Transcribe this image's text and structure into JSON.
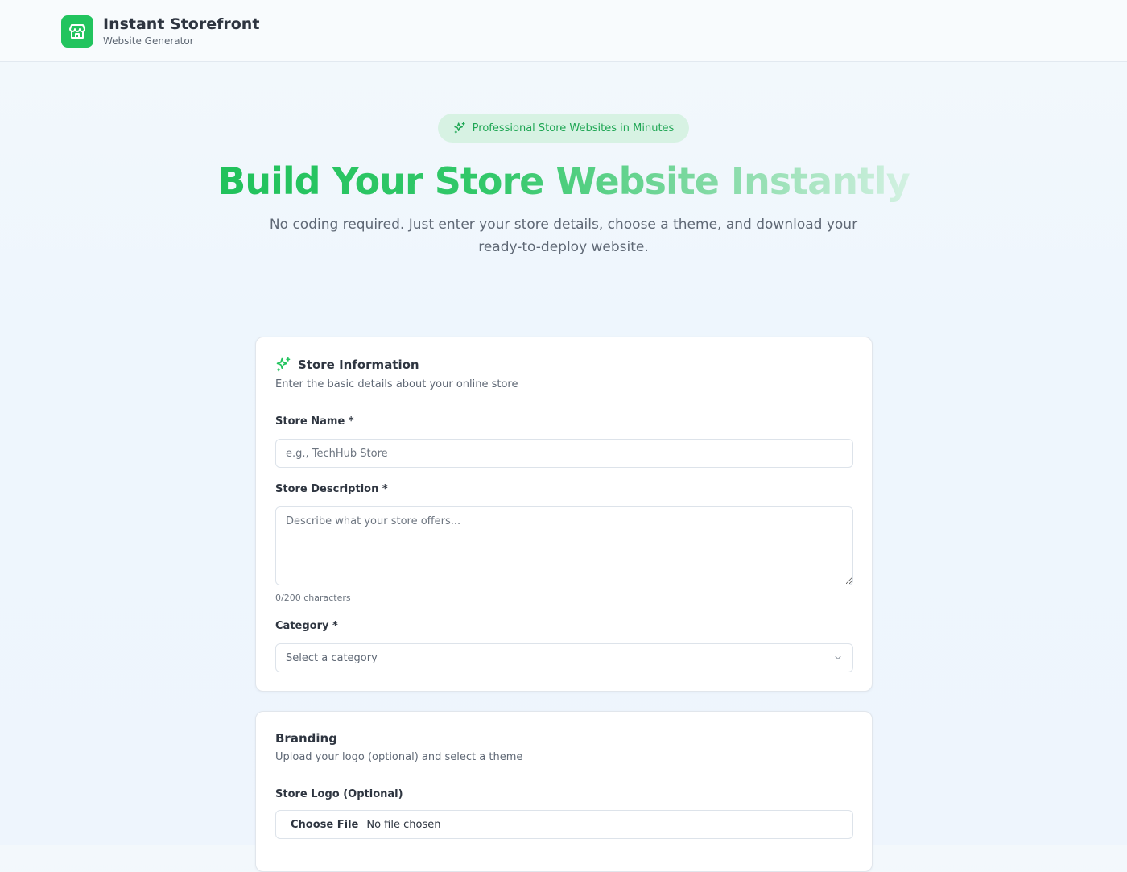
{
  "header": {
    "title": "Instant Storefront",
    "subtitle": "Website Generator"
  },
  "hero": {
    "badge": "Professional Store Websites in Minutes",
    "title": "Build Your Store Website Instantly",
    "subtitle": "No coding required. Just enter your store details, choose a theme, and download your ready-to-deploy website."
  },
  "store_info": {
    "title": "Store Information",
    "description": "Enter the basic details about your online store",
    "name_label": "Store Name *",
    "name_placeholder": "e.g., TechHub Store",
    "desc_label": "Store Description *",
    "desc_placeholder": "Describe what your store offers...",
    "char_count": "0/200 characters",
    "category_label": "Category *",
    "category_value": "Select a category"
  },
  "branding": {
    "title": "Branding",
    "description": "Upload your logo (optional) and select a theme",
    "logo_label": "Store Logo (Optional)",
    "file_button": "Choose File",
    "file_status": "No file chosen"
  },
  "colors": {
    "accent": "#22c45e",
    "badge_bg": "#d7f2e3"
  }
}
